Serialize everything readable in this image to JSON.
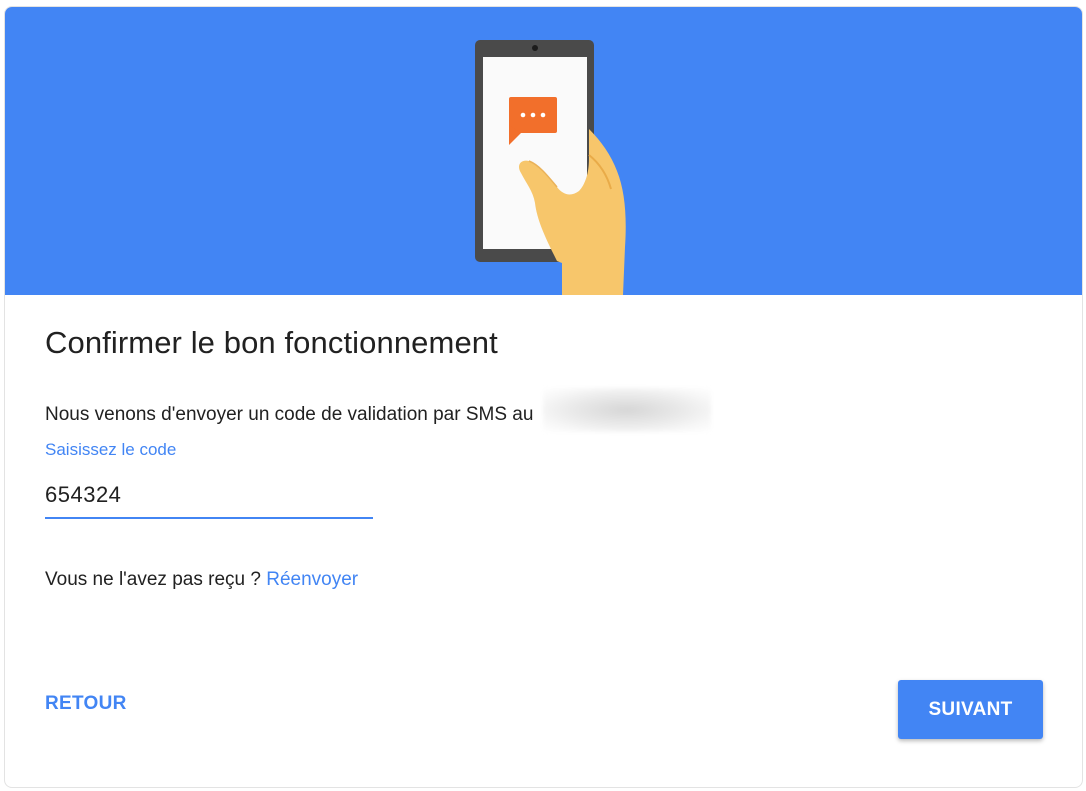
{
  "banner": {
    "illustration": "phone-sms-illustration",
    "background_color": "#4285f4"
  },
  "dialog": {
    "title": "Confirmer le bon fonctionnement",
    "description": "Nous venons d'envoyer un code de validation par SMS au"
  },
  "code_field": {
    "label": "Saisissez le code",
    "value": "654324"
  },
  "resend": {
    "prompt": "Vous ne l'avez pas reçu ?",
    "link_label": "Réenvoyer"
  },
  "actions": {
    "back_label": "RETOUR",
    "next_label": "SUIVANT"
  },
  "colors": {
    "accent": "#4285f4",
    "text": "#212121",
    "chat_bubble": "#f26f2b"
  }
}
